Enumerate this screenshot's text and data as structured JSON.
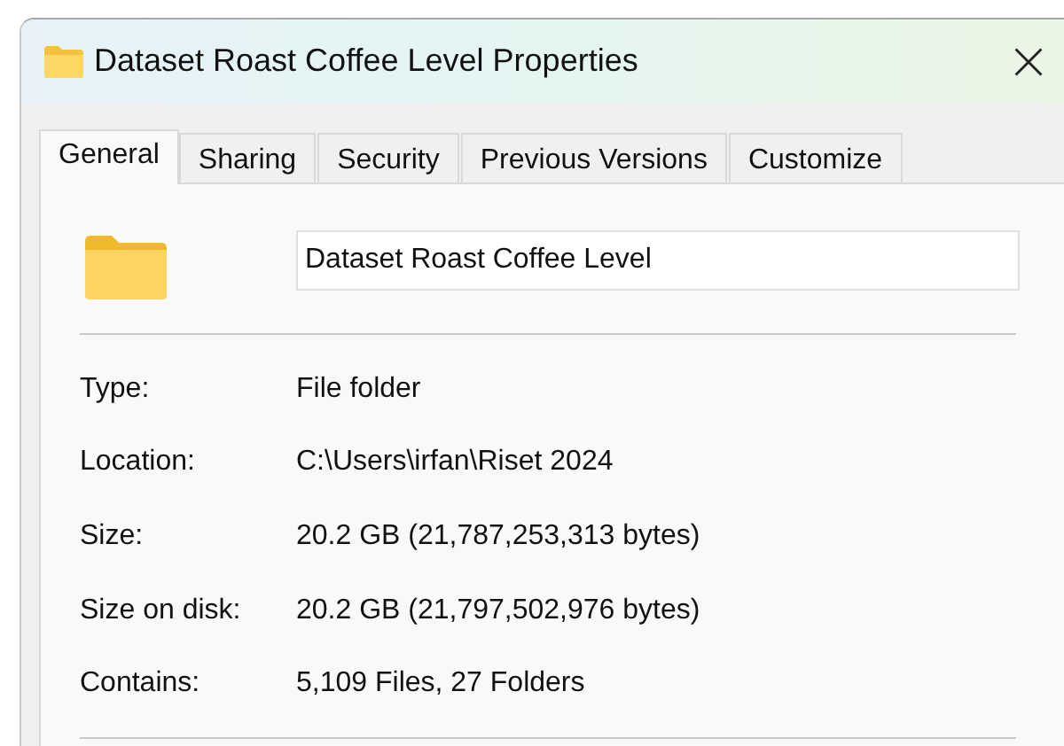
{
  "window": {
    "title": "Dataset Roast Coffee Level Properties"
  },
  "tabs": [
    {
      "label": "General",
      "selected": true
    },
    {
      "label": "Sharing",
      "selected": false
    },
    {
      "label": "Security",
      "selected": false
    },
    {
      "label": "Previous Versions",
      "selected": false
    },
    {
      "label": "Customize",
      "selected": false
    }
  ],
  "name_field": {
    "value": "Dataset Roast Coffee Level"
  },
  "properties": [
    {
      "label": "Type:",
      "value": "File folder"
    },
    {
      "label": "Location:",
      "value": "C:\\Users\\irfan\\Riset 2024"
    },
    {
      "label": "Size:",
      "value": "20.2 GB (21,787,253,313 bytes)"
    },
    {
      "label": "Size on disk:",
      "value": "20.2 GB (21,797,502,976 bytes)"
    },
    {
      "label": "Contains:",
      "value": "5,109 Files, 27 Folders"
    }
  ]
}
